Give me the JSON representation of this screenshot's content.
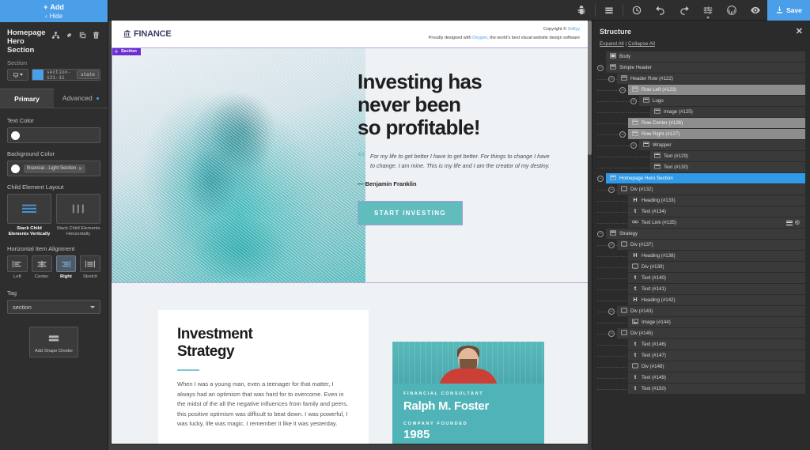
{
  "left_panel": {
    "add_button": "Add",
    "hide_button": "Hide",
    "element_title": "Homepage Hero Section",
    "element_tools": [
      "hierarchy-icon",
      "link-icon",
      "duplicate-icon",
      "trash-icon"
    ],
    "section_label": "Section",
    "selector_value": "section-131-11",
    "state_button": "state",
    "tabs": [
      {
        "label": "Primary",
        "active": true
      },
      {
        "label": "Advanced",
        "active": false
      }
    ],
    "text_color_label": "Text Color",
    "text_color_value": "#ffffff",
    "background_color_label": "Background Color",
    "background_color_chip": "financial - Light Section",
    "background_color_value": "#ffffff",
    "child_layout_label": "Child Element Layout",
    "child_layout_options": [
      {
        "label": "Stack Child Elements Vertically",
        "active": true
      },
      {
        "label": "Stack Child Elements Horizontally",
        "active": false
      }
    ],
    "align_label": "Horizontal Item Alignment",
    "align_options": [
      {
        "label": "Left",
        "active": false
      },
      {
        "label": "Center",
        "active": false
      },
      {
        "label": "Right",
        "active": true
      },
      {
        "label": "Stretch",
        "active": false
      }
    ],
    "tag_label": "Tag",
    "tag_value": "section",
    "shape_divider_button": "Add Shape Divider"
  },
  "toolbar": {
    "icons": [
      "bug-icon",
      "layers-icon",
      "history-clock-icon",
      "undo-icon",
      "redo-icon",
      "settings-sliders-icon",
      "wordpress-icon",
      "preview-eye-icon"
    ],
    "save_label": "Save"
  },
  "canvas": {
    "site_header": {
      "logo_text": "FINANCE",
      "copyright_prefix": "Copyright © ",
      "copyright_link": "Softyy",
      "credit_prefix": "Proudly designed with ",
      "credit_link": "Oxygen",
      "credit_suffix": ", the world's best visual website design software"
    },
    "section_badge": "Section",
    "hero": {
      "heading_line1": "Investing has",
      "heading_line2": "never been",
      "heading_line3": "so profitable!",
      "quote": "For my life to get better I have to get better. For things to change I have to change. I am mine. This is my life and I am the creator of my destiny.",
      "attribution": "— Benjamin Franklin",
      "cta_label": "START INVESTING"
    },
    "strategy": {
      "heading_line1": "Investment",
      "heading_line2": "Strategy",
      "paragraph": "When I was a young man, even a teenager for that matter, I always had an optimism that was hard for to overcome. Even in the midst of the all the negative influences from family and peers, this positive optimism was difficult to beat down. I was powerful, I was lucky, life was magic. I remember it like it was yesterday."
    },
    "person_card": {
      "kicker": "FINANCIAL CONSULTANT",
      "name": "Ralph M. Foster",
      "kicker2": "COMPANY FOUNDED",
      "founded": "1985"
    }
  },
  "structure": {
    "title": "Structure",
    "expand_all": "Expand All",
    "collapse_all": "Collapse All",
    "tree": [
      {
        "label": "Body",
        "depth": 0,
        "toggle": "",
        "icon": "body-icon",
        "state": ""
      },
      {
        "label": "Simple Header",
        "depth": 0,
        "toggle": "-",
        "icon": "section-icon",
        "state": ""
      },
      {
        "label": "Header Row (#122)",
        "depth": 1,
        "toggle": "-",
        "icon": "div-icon",
        "state": ""
      },
      {
        "label": "Row Left (#123)",
        "depth": 2,
        "toggle": "-",
        "icon": "div-icon",
        "state": "gray"
      },
      {
        "label": "Logo",
        "depth": 3,
        "toggle": "-",
        "icon": "div-icon",
        "state": ""
      },
      {
        "label": "Image (#125)",
        "depth": 4,
        "toggle": "",
        "icon": "div-icon",
        "state": ""
      },
      {
        "label": "Row Center (#126)",
        "depth": 2,
        "toggle": "",
        "icon": "div-icon",
        "state": "gray"
      },
      {
        "label": "Row Right (#127)",
        "depth": 2,
        "toggle": "-",
        "icon": "div-icon",
        "state": "gray"
      },
      {
        "label": "Wrapper",
        "depth": 3,
        "toggle": "-",
        "icon": "div-icon",
        "state": ""
      },
      {
        "label": "Text (#129)",
        "depth": 4,
        "toggle": "",
        "icon": "div-icon",
        "state": ""
      },
      {
        "label": "Text (#130)",
        "depth": 4,
        "toggle": "",
        "icon": "div-icon",
        "state": ""
      },
      {
        "label": "Homepage Hero Section",
        "depth": 0,
        "toggle": "-",
        "icon": "section-icon",
        "state": "blue"
      },
      {
        "label": "Div (#132)",
        "depth": 1,
        "toggle": "-",
        "icon": "div-box-icon",
        "state": ""
      },
      {
        "label": "Heading (#133)",
        "depth": 2,
        "toggle": "",
        "icon": "H",
        "state": ""
      },
      {
        "label": "Text (#134)",
        "depth": 2,
        "toggle": "",
        "icon": "t",
        "state": ""
      },
      {
        "label": "Text Link (#135)",
        "depth": 2,
        "toggle": "",
        "icon": "link-icon",
        "state": "",
        "actions": true
      },
      {
        "label": "Strategy",
        "depth": 0,
        "toggle": "-",
        "icon": "section-icon",
        "state": ""
      },
      {
        "label": "Div (#137)",
        "depth": 1,
        "toggle": "-",
        "icon": "div-box-icon",
        "state": ""
      },
      {
        "label": "Heading (#138)",
        "depth": 2,
        "toggle": "",
        "icon": "H",
        "state": ""
      },
      {
        "label": "Div (#139)",
        "depth": 2,
        "toggle": "",
        "icon": "div-box-icon",
        "state": ""
      },
      {
        "label": "Text (#140)",
        "depth": 2,
        "toggle": "",
        "icon": "t",
        "state": ""
      },
      {
        "label": "Text (#141)",
        "depth": 2,
        "toggle": "",
        "icon": "t",
        "state": ""
      },
      {
        "label": "Heading (#142)",
        "depth": 2,
        "toggle": "",
        "icon": "H",
        "state": ""
      },
      {
        "label": "Div (#143)",
        "depth": 1,
        "toggle": "-",
        "icon": "div-box-icon",
        "state": ""
      },
      {
        "label": "Image (#144)",
        "depth": 2,
        "toggle": "",
        "icon": "image-icon",
        "state": ""
      },
      {
        "label": "Div (#145)",
        "depth": 1,
        "toggle": "-",
        "icon": "div-box-icon",
        "state": ""
      },
      {
        "label": "Text (#146)",
        "depth": 2,
        "toggle": "",
        "icon": "t",
        "state": ""
      },
      {
        "label": "Text (#147)",
        "depth": 2,
        "toggle": "",
        "icon": "t",
        "state": ""
      },
      {
        "label": "Div (#148)",
        "depth": 2,
        "toggle": "",
        "icon": "div-box-icon",
        "state": ""
      },
      {
        "label": "Text (#149)",
        "depth": 2,
        "toggle": "",
        "icon": "t",
        "state": ""
      },
      {
        "label": "Text (#150)",
        "depth": 2,
        "toggle": "",
        "icon": "t",
        "state": ""
      }
    ]
  },
  "colors": {
    "accent_blue": "#4a9fe8",
    "teal": "#61bcbd",
    "purple_outline": "#b9a7e0",
    "badge_purple": "#6a2fd0"
  }
}
